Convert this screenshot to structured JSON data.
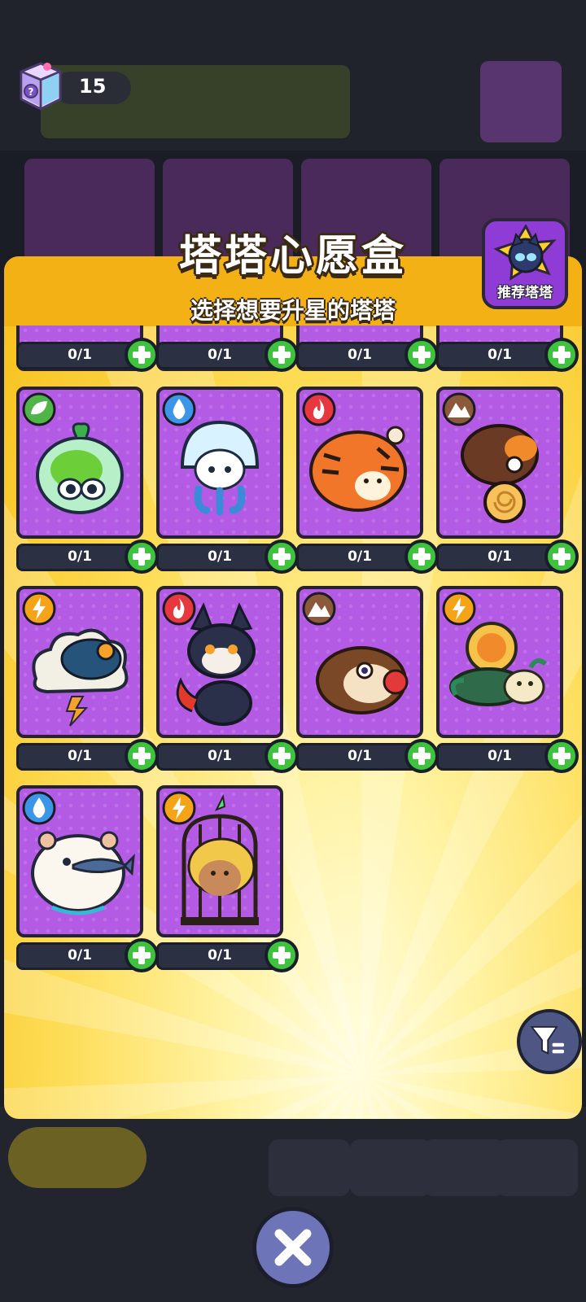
{
  "wish_box_counter": {
    "value": "15",
    "icon": "wish-box-icon"
  },
  "panel": {
    "title": "塔塔心愿盒",
    "subtitle": "选择想要升星的塔塔"
  },
  "recommend_button": {
    "label": "推荐塔塔",
    "icon": "recommend-cat-star-icon"
  },
  "partial_row": [
    {
      "count": "0/1"
    },
    {
      "count": "0/1"
    },
    {
      "count": "0/1"
    },
    {
      "count": "0/1"
    }
  ],
  "towers": [
    {
      "element": "nature",
      "creature": "green-bean-bag-frog",
      "count": "0/1"
    },
    {
      "element": "water",
      "creature": "jellyfish-kid",
      "count": "0/1"
    },
    {
      "element": "fire",
      "creature": "orange-tiger",
      "count": "0/1"
    },
    {
      "element": "earth",
      "creature": "snail-shell-mole",
      "count": "0/1"
    },
    {
      "element": "lightning",
      "creature": "thundercloud-blue-bird",
      "count": "0/1"
    },
    {
      "element": "fire",
      "creature": "black-fox-cat",
      "count": "0/1"
    },
    {
      "element": "earth",
      "creature": "brown-mole-boxer",
      "count": "0/1"
    },
    {
      "element": "lightning",
      "creature": "leaf-turtle-snail",
      "count": "0/1"
    },
    {
      "element": "water",
      "creature": "white-hamster-fish",
      "count": "0/1"
    },
    {
      "element": "lightning",
      "creature": "caged-lion-cub",
      "count": "0/1"
    }
  ],
  "element_colors": {
    "nature": "#4fb548",
    "water": "#3b96e8",
    "fire": "#e8383f",
    "earth": "#8a5a3a",
    "lightning": "#f5a417"
  },
  "buttons": {
    "add_icon": "plus-icon",
    "filter_icon": "filter-icon",
    "close_icon": "close-icon"
  }
}
